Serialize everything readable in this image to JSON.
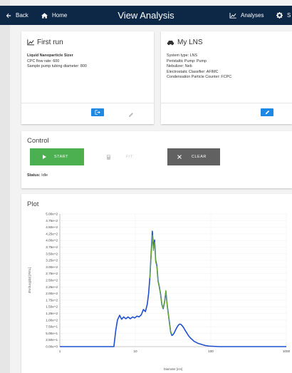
{
  "nav": {
    "back": "Back",
    "home": "Home",
    "title": "View Analysis",
    "analyses": "Analyses",
    "settings_initial": "S"
  },
  "run_card": {
    "title": "First run",
    "instrument": "Liquid Nanoparticle Sizer",
    "cpc_flow": "CPC flow rate: 600",
    "tubing": "Sample pump tubing diameter: 800"
  },
  "system_card": {
    "title": "My LNS",
    "system_type": "System type: LNS",
    "pump": "Peristaltic Pump: Pump",
    "nebulizer": "Nebulizer: Neb",
    "classifier": "Electrostatic Classifier: AFIMC",
    "counter": "Condensation Particle Counter: FCPC"
  },
  "control": {
    "title": "Control",
    "start": "START",
    "fit": "FIT",
    "clear": "CLEAR",
    "status_label": "Status:",
    "status_value": "Idle"
  },
  "plot": {
    "title": "Plot"
  },
  "colors": {
    "navbar": "#0d2746",
    "primary_blue": "#1e88e5",
    "start_green": "#4caf50",
    "clear_grey": "#616161",
    "series_main": "#1f4fd1",
    "series_fit": "#66a832"
  },
  "chart_data": {
    "type": "line",
    "xlabel": "Diameter [nm]",
    "ylabel": "dN/dLog(dp) [#/mL]",
    "x_scale": "log",
    "xlim": [
      1,
      1000
    ],
    "ylim": [
      0,
      500
    ],
    "x_ticks": [
      "1",
      "10",
      "100",
      "1000"
    ],
    "y_ticks": [
      "0.00e+0",
      "2.50e+1",
      "5.00e+1",
      "7.50e+1",
      "1.00e+2",
      "1.25e+2",
      "1.50e+2",
      "1.75e+2",
      "2.00e+2",
      "2.25e+2",
      "2.50e+2",
      "2.75e+2",
      "3.00e+2",
      "3.25e+2",
      "3.50e+2",
      "3.75e+2",
      "4.00e+2",
      "4.25e+2",
      "4.50e+2",
      "4.75e+2",
      "5.00e+2"
    ],
    "series": [
      {
        "x": [
          1,
          3,
          5.2,
          5.5,
          5.8,
          6.2,
          6.6,
          7,
          7.5,
          8,
          8.6,
          9.2,
          9.8,
          10.5,
          11.2,
          12,
          12.8,
          13.6,
          14.4,
          15,
          15.6,
          16.2,
          16.8,
          17.4,
          18,
          18.6,
          19.3,
          20,
          20.8,
          21.6,
          22.5,
          23.4,
          24.4,
          25.4,
          26.4,
          27.4,
          28.4,
          29.4,
          30.5,
          31.6,
          32.8,
          34,
          35.5,
          37,
          38.5,
          40,
          42,
          44,
          46,
          48.5,
          51,
          54,
          57,
          60,
          64,
          68,
          72,
          78,
          85,
          95,
          110,
          130,
          1000
        ],
        "y": [
          0,
          0,
          0,
          60,
          100,
          118,
          103,
          112,
          105,
          112,
          105,
          112,
          108,
          115,
          112,
          120,
          140,
          132,
          160,
          200,
          262,
          350,
          435,
          372,
          402,
          325,
          305,
          248,
          225,
          198,
          158,
          143,
          168,
          208,
          158,
          122,
          88,
          55,
          42,
          45,
          52,
          62,
          72,
          80,
          85,
          84,
          78,
          70,
          60,
          50,
          40,
          32,
          26,
          20,
          16,
          12,
          10,
          7,
          4,
          2,
          1,
          0,
          0
        ]
      },
      {
        "x": [
          15.6,
          16.2,
          16.8,
          17.4,
          18,
          18.6,
          19.3,
          20,
          20.8,
          21.6,
          22.5,
          23.4,
          24.4,
          25.4,
          26.4,
          27.4,
          28.4,
          29.4,
          30.5
        ],
        "y": [
          258,
          340,
          420,
          362,
          394,
          320,
          300,
          245,
          222,
          196,
          158,
          145,
          170,
          212,
          155,
          120,
          84,
          58,
          46
        ]
      }
    ]
  }
}
